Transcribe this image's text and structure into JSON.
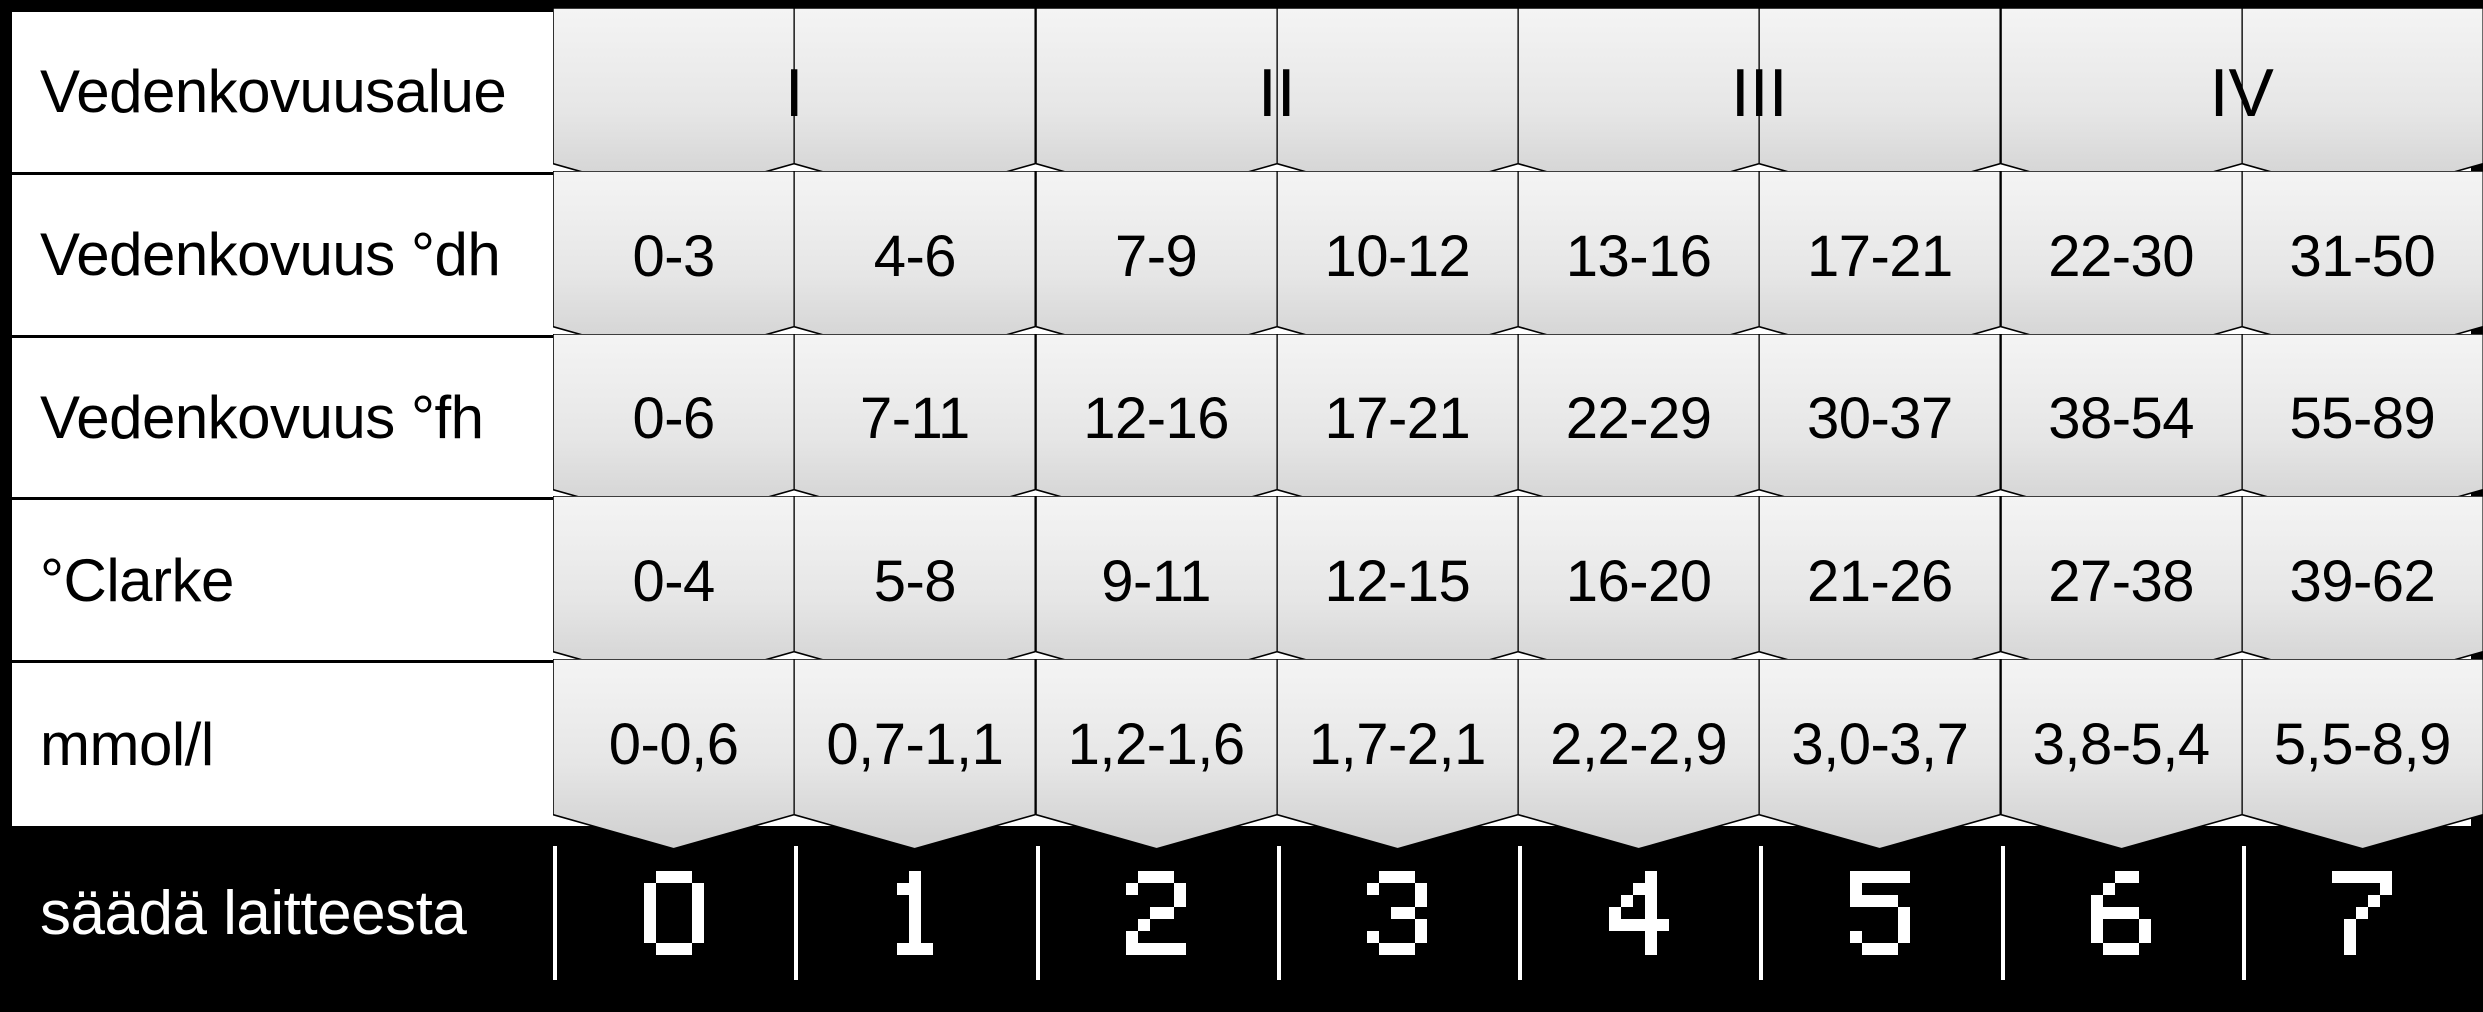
{
  "labels": {
    "range": "Vedenkovuusalue",
    "dh": "Vedenkovuus  °dh",
    "fh": "Vedenkovuus  °fh",
    "clarke": "°Clarke",
    "mmol": "mmol/l",
    "footer": "säädä laitteesta"
  },
  "header_roman": [
    "I",
    "II",
    "III",
    "IV"
  ],
  "rows": {
    "dh": [
      "0-3",
      "4-6",
      "7-9",
      "10-12",
      "13-16",
      "17-21",
      "22-30",
      "31-50"
    ],
    "fh": [
      "0-6",
      "7-11",
      "12-16",
      "17-21",
      "22-29",
      "30-37",
      "38-54",
      "55-89"
    ],
    "clarke": [
      "0-4",
      "5-8",
      "9-11",
      "12-15",
      "16-20",
      "21-26",
      "27-38",
      "39-62"
    ],
    "mmol": [
      "0-0,6",
      "0,7-1,1",
      "1,2-1,6",
      "1,7-2,1",
      "2,2-2,9",
      "3,0-3,7",
      "3,8-5,4",
      "5,5-8,9"
    ]
  },
  "footer_numbers": [
    "0",
    "1",
    "2",
    "3",
    "4",
    "5",
    "6",
    "7"
  ]
}
